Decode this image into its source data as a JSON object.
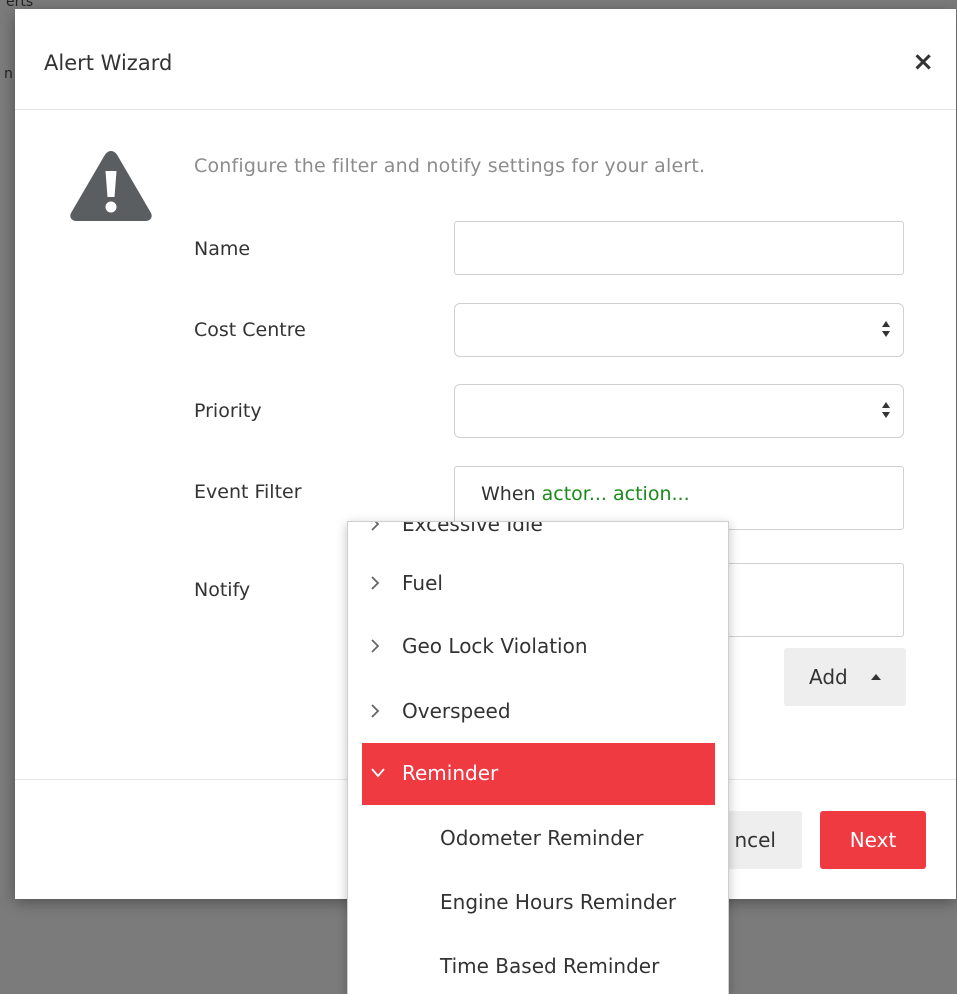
{
  "background": {
    "top_fragment": "erts",
    "side_fragment": "n"
  },
  "modal": {
    "title": "Alert Wizard",
    "close_symbol": "×",
    "intro": "Configure the filter and notify settings for your alert.",
    "warning_icon": "warning-triangle-icon",
    "fields": {
      "name": {
        "label": "Name",
        "value": ""
      },
      "cost_centre": {
        "label": "Cost Centre",
        "value": ""
      },
      "priority": {
        "label": "Priority",
        "value": ""
      },
      "event_filter": {
        "label": "Event Filter",
        "prefix": "When",
        "actor": "actor...",
        "action": "action..."
      },
      "notify": {
        "label": "Notify",
        "value": ""
      }
    },
    "add_button": "Add",
    "footer": {
      "cancel_label": "ncel",
      "next_label": "Next"
    }
  },
  "dropdown": {
    "partial_item": "Excessive Idle",
    "items": [
      {
        "label": "Fuel",
        "expanded": false
      },
      {
        "label": "Geo Lock Violation",
        "expanded": false
      },
      {
        "label": "Overspeed",
        "expanded": false
      },
      {
        "label": "Reminder",
        "expanded": true
      }
    ],
    "sub_items": [
      "Odometer Reminder",
      "Engine Hours Reminder",
      "Time Based Reminder"
    ]
  },
  "colors": {
    "accent": "#ef3a42",
    "green_link": "#1a8a1a",
    "overlay": "#7b7b7b"
  }
}
